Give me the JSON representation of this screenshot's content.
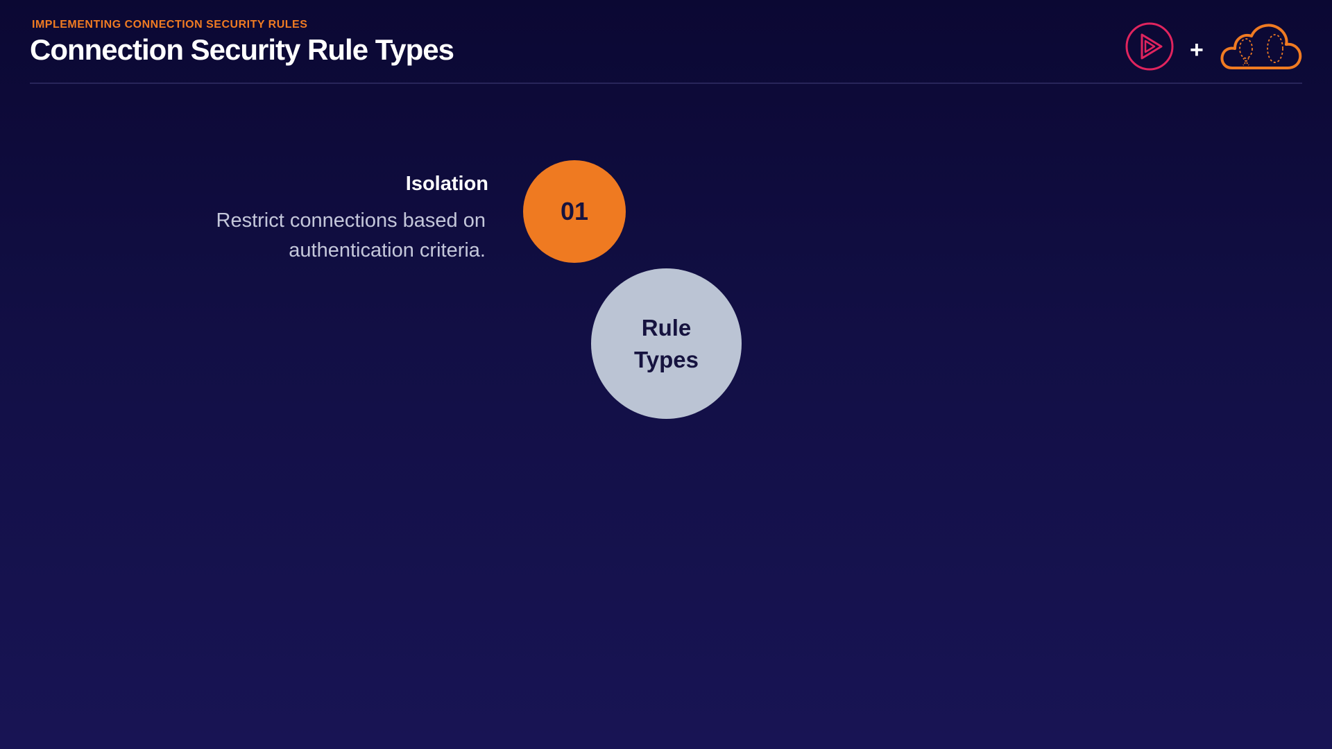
{
  "header": {
    "eyebrow": "IMPLEMENTING CONNECTION SECURITY RULES",
    "title": "Connection Security Rule Types",
    "logos": {
      "play_icon": "play-triangle-icon",
      "separator": "+",
      "cloud_icon": "cloud-icon"
    }
  },
  "content": {
    "steps": [
      {
        "number": "01",
        "title": "Isolation",
        "description_line1": "Restrict connections based on",
        "description_line2": "authentication criteria."
      }
    ],
    "center": {
      "line1": "Rule",
      "line2": "Types"
    }
  },
  "colors": {
    "accent_orange": "#ef7a21",
    "background_top": "#0b0833",
    "background_bottom": "#181454",
    "center_circle": "#bbc4d4",
    "play_icon_pink": "#e0245e"
  }
}
